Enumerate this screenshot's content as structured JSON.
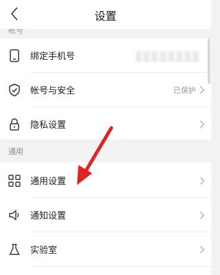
{
  "header": {
    "title": "设置",
    "back_icon": "chevron-left-icon"
  },
  "partial_section_label": "帐号",
  "account": {
    "items": [
      {
        "label": "绑定手机号",
        "icon": "phone-icon",
        "value": ""
      },
      {
        "label": "帐号与安全",
        "icon": "shield-check-icon",
        "value": "已保护"
      },
      {
        "label": "隐私设置",
        "icon": "lock-icon",
        "value": ""
      }
    ]
  },
  "general": {
    "section_label": "通用",
    "items": [
      {
        "label": "通用设置",
        "icon": "grid-icon"
      },
      {
        "label": "通知设置",
        "icon": "speaker-icon"
      },
      {
        "label": "实验室",
        "icon": "flask-icon"
      }
    ]
  },
  "colors": {
    "annotation_arrow": "#e02424"
  }
}
